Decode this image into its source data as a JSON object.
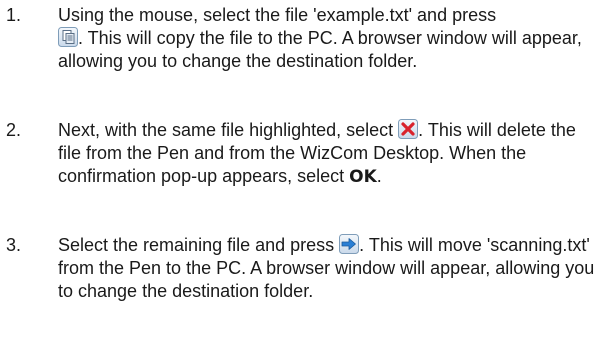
{
  "steps": [
    {
      "number": "1.",
      "text_before_icon": "Using the mouse, select the file 'example.txt' and press ",
      "icon": "copy-to-pc-icon",
      "text_after_icon": ". This will copy the file to the PC. A browser window will appear, allowing you to change the destination folder."
    },
    {
      "number": "2.",
      "text_before_icon": "Next, with the same file highlighted, select ",
      "icon": "delete-icon",
      "text_after_icon": ". This will delete the file from the Pen and from the WizCom Desktop. When the confirmation pop-up appears, select ",
      "bold_text": "OK",
      "text_end": "."
    },
    {
      "number": "3.",
      "text_before_icon": "Select the remaining file and press ",
      "icon": "move-to-pc-icon",
      "text_after_icon": ". This will move 'scanning.txt' from the Pen to the PC. A browser window will appear, allowing you to change the destination folder."
    }
  ],
  "colors": {
    "text": "#1a1a1a",
    "icon_frame": "#7f9db9",
    "delete_red": "#d9232d",
    "move_blue": "#2a7fd4"
  }
}
